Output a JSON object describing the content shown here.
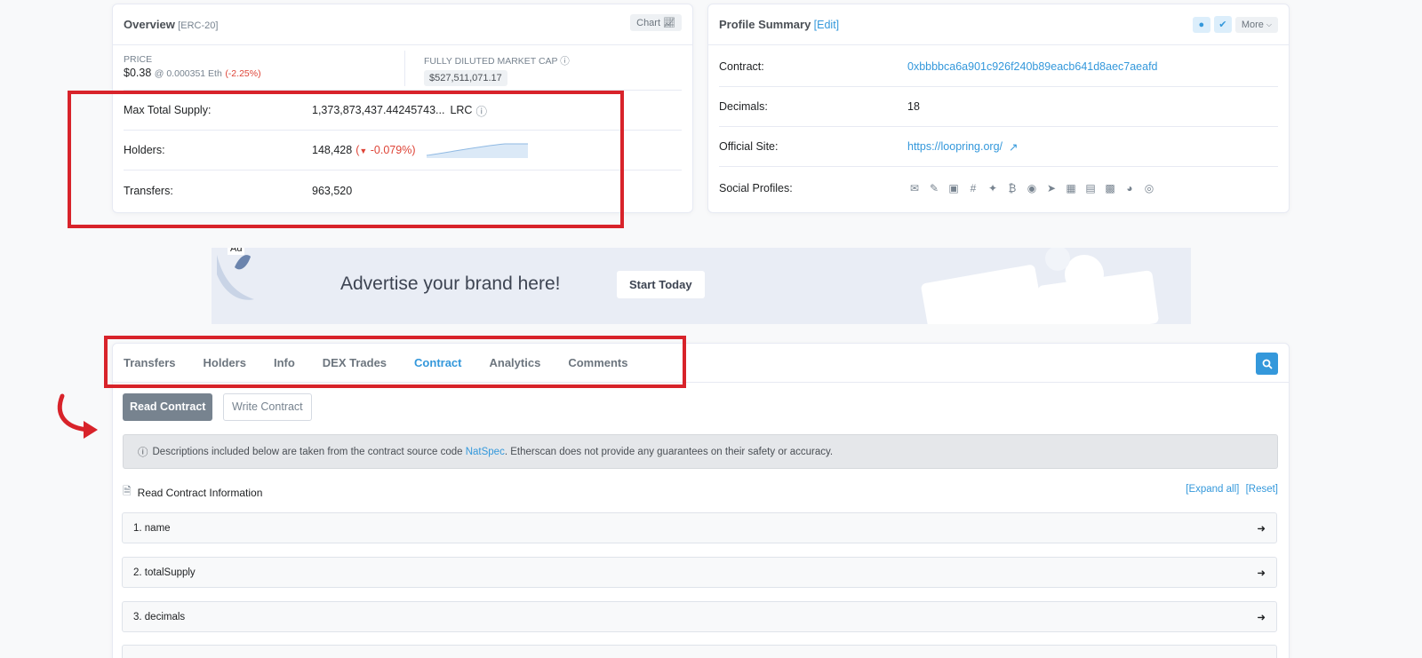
{
  "overview": {
    "title": "Overview",
    "token_type": "[ERC-20]",
    "chart_button": "Chart",
    "price_label": "PRICE",
    "price_value": "$0.38",
    "price_eth": "@ 0.000351 Eth",
    "price_change": "(-2.25%)",
    "mcap_label": "FULLY DILUTED MARKET CAP",
    "mcap_value": "$527,511,071.17",
    "max_supply_label": "Max Total Supply:",
    "max_supply_value": "1,373,873,437.44245743...",
    "max_supply_unit": "LRC",
    "holders_label": "Holders:",
    "holders_value": "148,428",
    "holders_change": "-0.079%)",
    "holders_change_open": "(",
    "transfers_label": "Transfers:",
    "transfers_value": "963,520"
  },
  "profile": {
    "title": "Profile Summary",
    "edit": "[Edit]",
    "more": "More",
    "contract_label": "Contract:",
    "contract_value": "0xbbbbca6a901c926f240b89eacb641d8aec7aeafd",
    "decimals_label": "Decimals:",
    "decimals_value": "18",
    "site_label": "Official Site:",
    "site_value": "https://loopring.org/",
    "social_label": "Social Profiles:",
    "social_icons": [
      "email-icon",
      "pencil-icon",
      "blog-icon",
      "slack-icon",
      "twitter-icon",
      "bitcointalk-icon",
      "github-icon",
      "telegram-icon",
      "linkedin-icon",
      "discord-icon",
      "whitepaper-icon",
      "reddit-icon",
      "medium-icon"
    ]
  },
  "ad": {
    "tag": "Ad",
    "headline": "Advertise your brand here!",
    "cta": "Start Today"
  },
  "tabs": [
    "Transfers",
    "Holders",
    "Info",
    "DEX Trades",
    "Contract",
    "Analytics",
    "Comments"
  ],
  "active_tab": "Contract",
  "contract": {
    "read_button": "Read Contract",
    "write_button": "Write Contract",
    "notice_pre": "Descriptions included below are taken from the contract source code ",
    "notice_link": "NatSpec",
    "notice_post": ". Etherscan does not provide any guarantees on their safety or accuracy.",
    "info_label": "Read Contract Information",
    "expand_all": "[Expand all]",
    "reset": "[Reset]",
    "items": [
      "1. name",
      "2. totalSupply",
      "3. decimals"
    ]
  },
  "colors": {
    "accent": "#3498db",
    "highlight": "#d8232a",
    "negative": "#de4437"
  }
}
